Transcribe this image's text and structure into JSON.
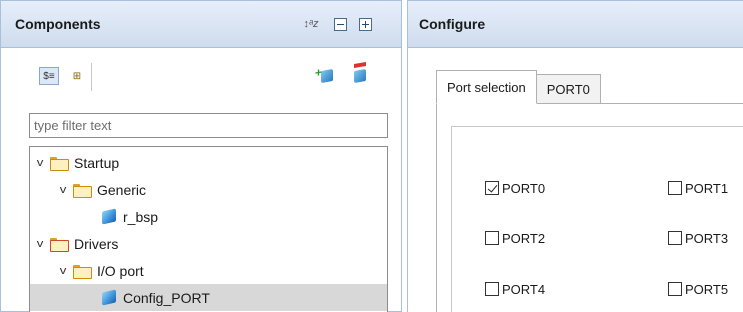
{
  "components_panel": {
    "title": "Components",
    "filter_placeholder": "type filter text",
    "tree": [
      {
        "label": "Startup",
        "level": 0,
        "expanded": true,
        "kind": "folder"
      },
      {
        "label": "Generic",
        "level": 1,
        "expanded": true,
        "kind": "folder"
      },
      {
        "label": "r_bsp",
        "level": 2,
        "kind": "component"
      },
      {
        "label": "Drivers",
        "level": 0,
        "expanded": true,
        "kind": "folder-red"
      },
      {
        "label": "I/O port",
        "level": 1,
        "expanded": true,
        "kind": "folder"
      },
      {
        "label": "Config_PORT",
        "level": 2,
        "kind": "component",
        "selected": true
      }
    ]
  },
  "configure_panel": {
    "title": "Configure",
    "tabs": [
      {
        "label": "Port selection",
        "active": true
      },
      {
        "label": "PORT0",
        "active": false
      }
    ],
    "ports": [
      {
        "label": "PORT0",
        "checked": true
      },
      {
        "label": "PORT1",
        "checked": false
      },
      {
        "label": "PORT2",
        "checked": false
      },
      {
        "label": "PORT3",
        "checked": false
      },
      {
        "label": "PORT4",
        "checked": false
      },
      {
        "label": "PORT5",
        "checked": false
      }
    ]
  },
  "icons": {
    "sort": "sort-alpha-icon",
    "collapse_all": "collapse-all-icon",
    "expand_all": "expand-all-icon",
    "add_component": "add-component-icon",
    "remove_component": "remove-component-icon"
  },
  "colors": {
    "header_top": "#e6eefa",
    "header_bottom": "#cfdcee",
    "panel_border": "#a8c0dc",
    "selected_row": "#d8d8d8"
  }
}
